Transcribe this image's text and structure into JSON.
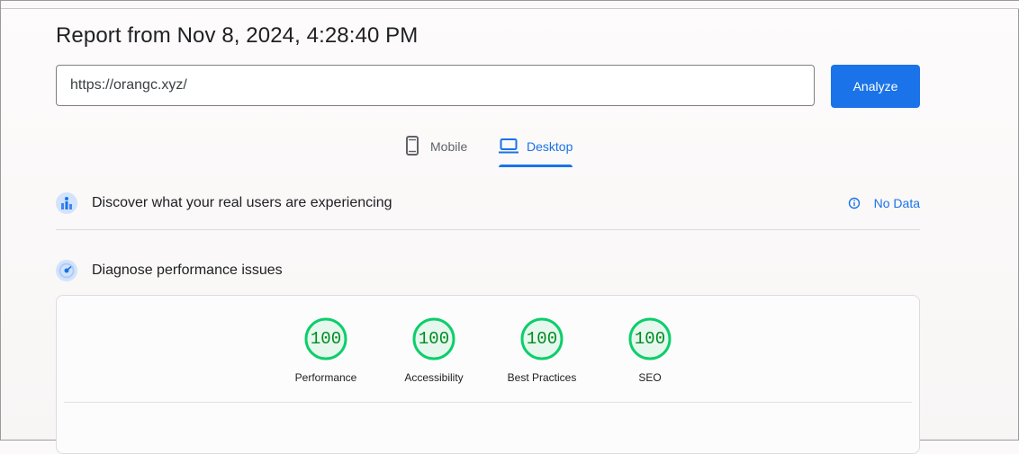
{
  "report": {
    "title": "Report from Nov 8, 2024, 4:28:40 PM"
  },
  "search": {
    "value": "https://orangc.xyz/",
    "analyze_label": "Analyze"
  },
  "tabs": [
    {
      "label": "Mobile",
      "icon": "phone-icon",
      "selected": false
    },
    {
      "label": "Desktop",
      "icon": "laptop-icon",
      "selected": true
    }
  ],
  "field_data": {
    "title": "Discover what your real users are experiencing",
    "status": "No Data"
  },
  "lab_data": {
    "title": "Diagnose performance issues"
  },
  "scores": [
    {
      "label": "Performance",
      "value": "100"
    },
    {
      "label": "Accessibility",
      "value": "100"
    },
    {
      "label": "Best Practices",
      "value": "100"
    },
    {
      "label": "SEO",
      "value": "100"
    }
  ],
  "colors": {
    "accent": "#1a73e8",
    "pass": "#0cce6b",
    "pass_text": "#008a22",
    "pass_fill": "#e6f8ed"
  }
}
